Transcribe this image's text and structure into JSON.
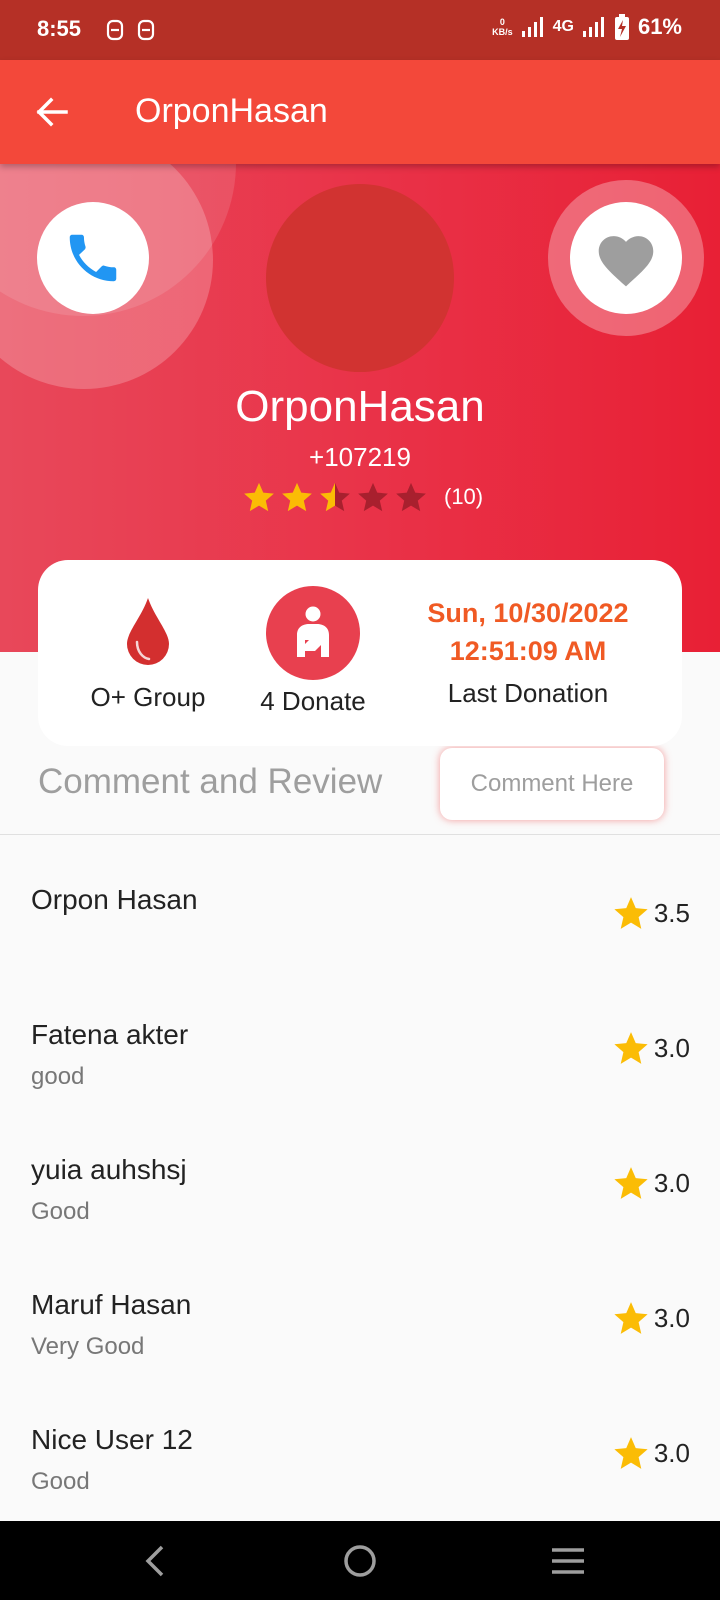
{
  "status_bar": {
    "time": "8:55",
    "net_speed_value": "0",
    "net_speed_unit": "KB/s",
    "network": "4G",
    "battery": "61%"
  },
  "app_bar": {
    "title": "OrponHasan"
  },
  "profile": {
    "name": "OrponHasan",
    "phone": "+107219",
    "rating_value": 2.5,
    "rating_count": "(10)"
  },
  "info": {
    "blood_group": "O+ Group",
    "donate_count": "4 Donate",
    "last_donation_date": "Sun, 10/30/2022",
    "last_donation_time": "12:51:09 AM",
    "last_donation_label": "Last Donation"
  },
  "reviews_section": {
    "title": "Comment and Review",
    "comment_button": "Comment Here"
  },
  "reviews": [
    {
      "name": "Orpon Hasan",
      "comment": "",
      "rating": "3.5"
    },
    {
      "name": "Fatena akter",
      "comment": "good",
      "rating": "3.0"
    },
    {
      "name": "yuia auhshsj",
      "comment": "Good",
      "rating": "3.0"
    },
    {
      "name": "Maruf Hasan",
      "comment": "Very Good",
      "rating": "3.0"
    },
    {
      "name": "Nice User 12",
      "comment": "Good",
      "rating": "3.0"
    }
  ],
  "colors": {
    "status_bar": "#b53026",
    "app_bar": "#f3483a",
    "accent_red": "#e8404f",
    "star": "#fbbc05",
    "date_orange": "#f05a24",
    "call_icon": "#2196f3"
  }
}
